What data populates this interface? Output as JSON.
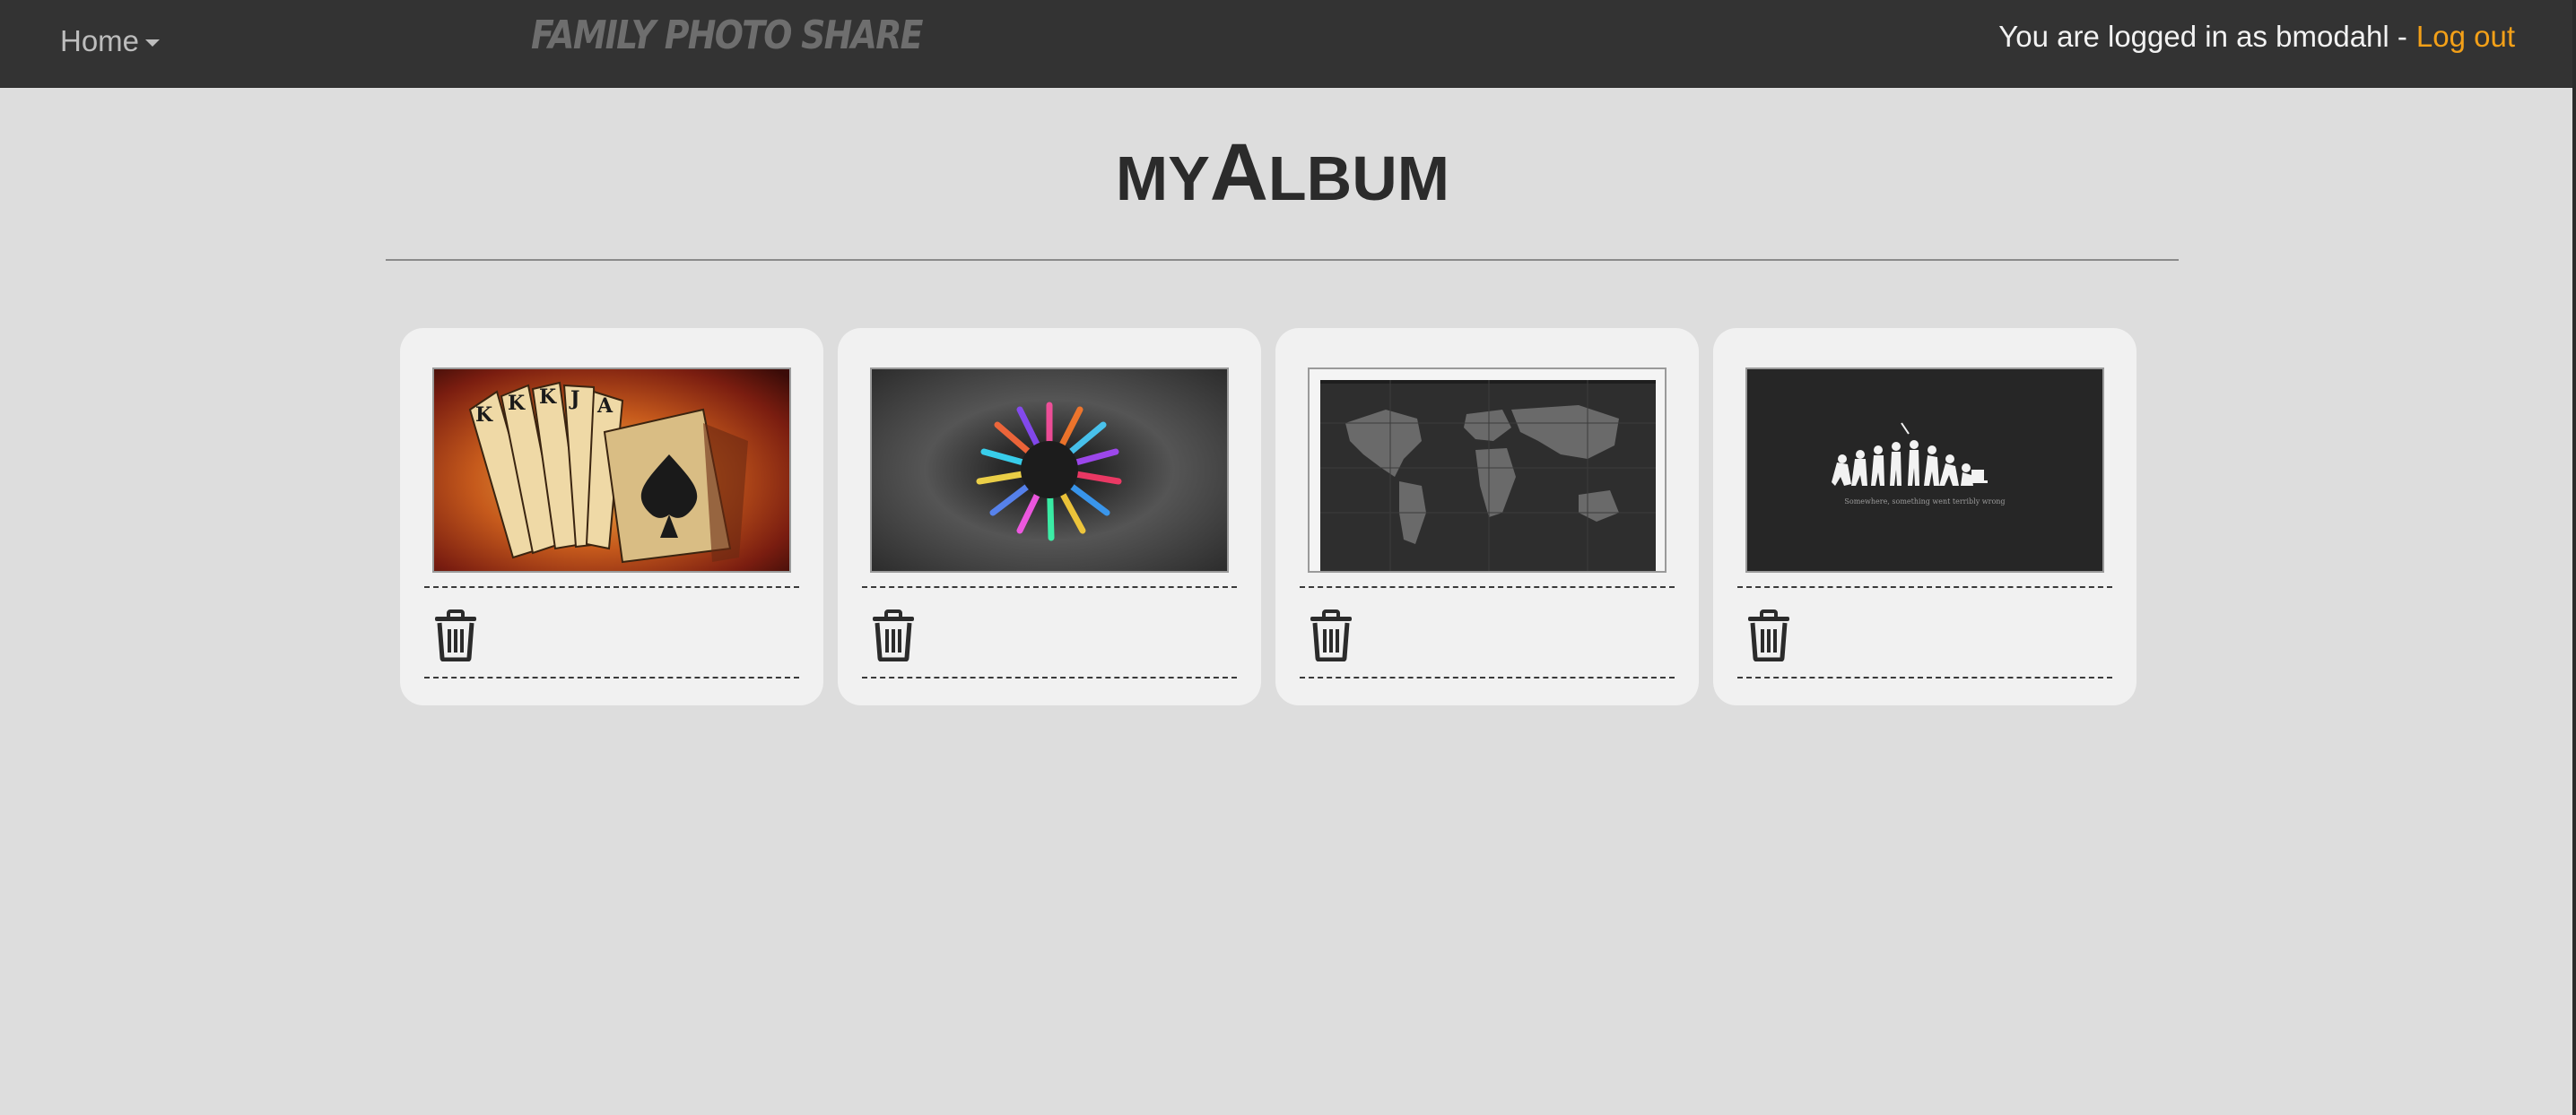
{
  "nav": {
    "home_label": "Home",
    "brand": "FAMILY PHOTO SHARE",
    "login_text": "You are logged in as bmodahl -",
    "logout_label": "Log out",
    "accent_color": "#f3a018"
  },
  "page": {
    "title_prefix": "MY",
    "title_initial": "A",
    "title_rest": "LBUM"
  },
  "photos": [
    {
      "icon": "trash-icon"
    },
    {
      "icon": "trash-icon"
    },
    {
      "icon": "trash-icon"
    },
    {
      "icon": "trash-icon"
    }
  ],
  "evolution_caption": "Somewhere, something went terribly wrong"
}
